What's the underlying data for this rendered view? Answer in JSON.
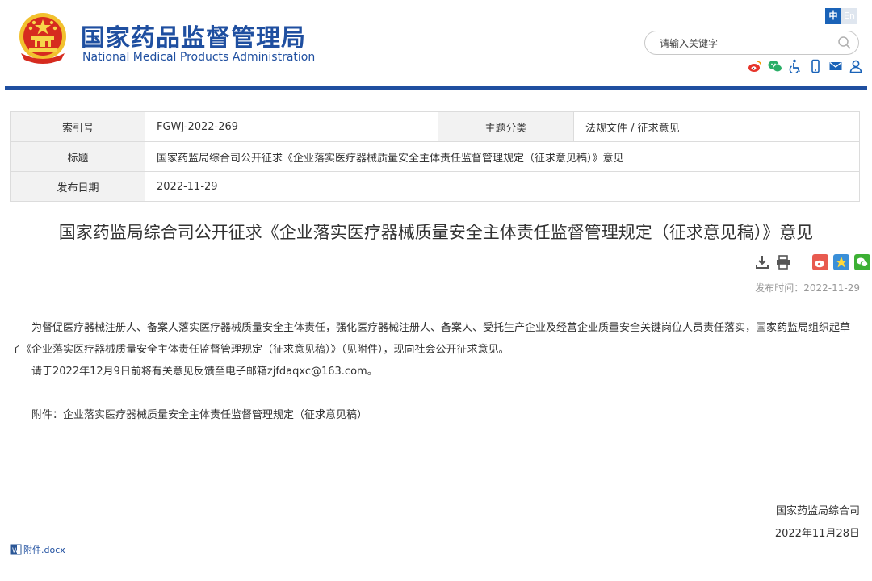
{
  "header": {
    "site_name_cn": "国家药品监督管理局",
    "site_name_en": "National Medical Products Administration",
    "lang_cn": "中",
    "lang_en": "En",
    "search_placeholder": "请输入关键字",
    "icons": [
      "weibo-icon",
      "wechat-icon",
      "accessibility-icon",
      "mobile-icon",
      "mail-icon",
      "user-icon"
    ]
  },
  "meta": {
    "index_label": "索引号",
    "index_value": "FGWJ-2022-269",
    "category_label": "主题分类",
    "category_value": "法规文件 / 征求意见",
    "title_label": "标题",
    "title_value": "国家药监局综合司公开征求《企业落实医疗器械质量安全主体责任监督管理规定（征求意见稿）》意见",
    "date_label": "发布日期",
    "date_value": "2022-11-29"
  },
  "article": {
    "title": "国家药监局综合司公开征求《企业落实医疗器械质量安全主体责任监督管理规定（征求意见稿）》意见",
    "publish_time": "发布时间：2022-11-29",
    "paragraphs": [
      "为督促医疗器械注册人、备案人落实医疗器械质量安全主体责任，强化医疗器械注册人、备案人、受托生产企业及经营企业质量安全关键岗位人员责任落实，国家药监局组织起草了《企业落实医疗器械质量安全主体责任监督管理规定（征求意见稿）》（见附件），现向社会公开征求意见。",
      "请于2022年12月9日前将有关意见反馈至电子邮箱zjfdaqxc@163.com。",
      "附件：企业落实医疗器械质量安全主体责任监督管理规定（征求意见稿）"
    ],
    "signature": "国家药监局综合司",
    "sign_date": "2022年11月28日",
    "attachment": "附件.docx"
  },
  "colors": {
    "brand": "#1f4fa0",
    "accent": "#1a63b8"
  }
}
